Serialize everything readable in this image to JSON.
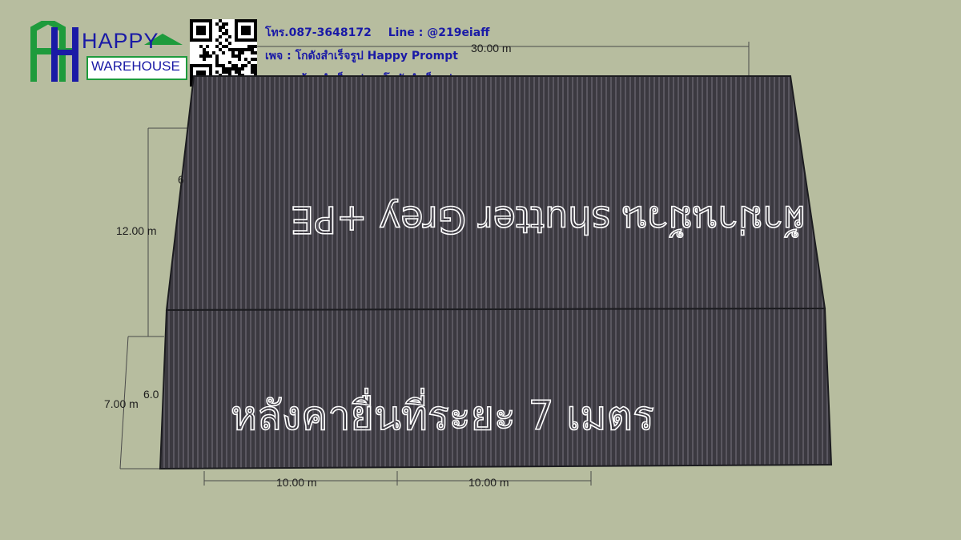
{
  "contact": {
    "phone": "โทร.087-3648172",
    "line": "Line : @219eiaff",
    "page": "เพจ : โกดังสำเร็จรูป Happy Prompt",
    "website": "www.บ้านสำเร็จรูปและโกดังสำเร็จรูป.com"
  },
  "logo": {
    "line1": "HAPPY",
    "line2": "WAREHOUSE",
    "colors": {
      "green": "#1e9b3c",
      "blue": "#1a1aa6"
    }
  },
  "dimensions": {
    "top_width": "30.00 m",
    "left_length_upper": "12.00 m",
    "left_length_lower": "7.00 m",
    "partial_upper": "6",
    "partial_lower": "6.0",
    "bottom_left": "10.00 m",
    "bottom_right": "10.00 m"
  },
  "roof_labels": {
    "upper_mirrored": "ผ้าม่านม้วน shutter Grey +PE",
    "lower": "หลังคายื่นที่ระยะ 7 เมตร"
  },
  "colors": {
    "background": "#b7bd9f",
    "roof_dark": "#3b3940",
    "roof_light": "#5a5760"
  }
}
